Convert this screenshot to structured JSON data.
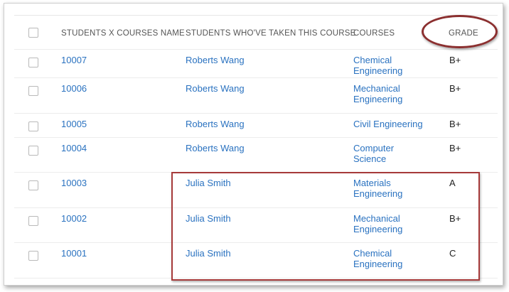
{
  "table": {
    "headers": {
      "name": "STUDENTS X COURSES NAME",
      "student": "STUDENTS WHO'VE TAKEN THIS COURSE",
      "course": "COURSES",
      "grade": "GRADE"
    },
    "rows": [
      {
        "id": "10007",
        "student": "Roberts Wang",
        "course": "Chemical\nEngineering",
        "grade": "B+"
      },
      {
        "id": "10006",
        "student": "Roberts Wang",
        "course": "Mechanical\nEngineering",
        "grade": "B+"
      },
      {
        "id": "10005",
        "student": "Roberts Wang",
        "course": "Civil Engineering",
        "grade": "B+"
      },
      {
        "id": "10004",
        "student": "Roberts Wang",
        "course": "Computer\nScience",
        "grade": "B+"
      },
      {
        "id": "10003",
        "student": "Julia Smith",
        "course": "Materials\nEngineering",
        "grade": "A"
      },
      {
        "id": "10002",
        "student": "Julia Smith",
        "course": "Mechanical\nEngineering",
        "grade": "B+"
      },
      {
        "id": "10001",
        "student": "Julia Smith",
        "course": "Chemical\nEngineering",
        "grade": "C"
      }
    ]
  },
  "colors": {
    "link": "#2a72c0",
    "annotation": "#8b2f2f"
  }
}
